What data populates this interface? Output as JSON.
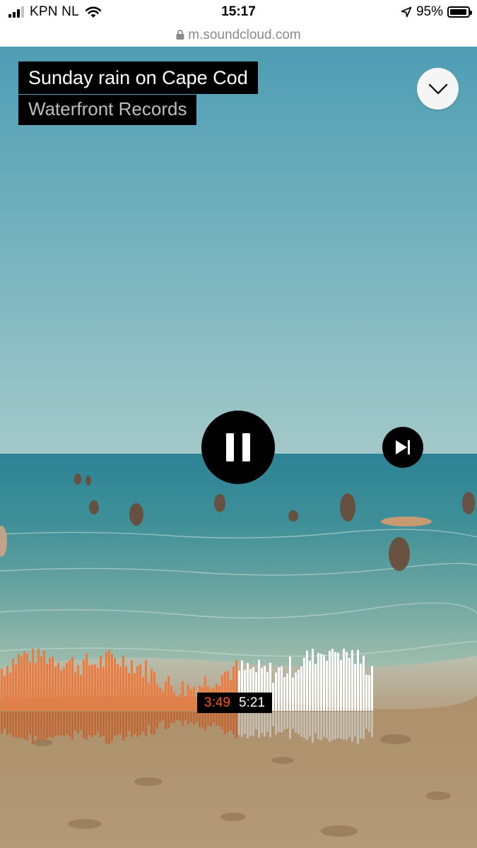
{
  "status_bar": {
    "carrier": "KPN NL",
    "time": "15:17",
    "battery_percent": "95%",
    "battery_level": 0.95,
    "icons": [
      "signal-icon",
      "wifi-icon",
      "location-arrow-icon",
      "battery-icon"
    ]
  },
  "browser": {
    "url": "m.soundcloud.com",
    "icons": [
      "lock-icon"
    ]
  },
  "track": {
    "title": "Sunday rain on Cape Cod",
    "artist": "Waterfront Records"
  },
  "controls": {
    "collapse_icon": "chevron-down-icon",
    "play_state_icon": "pause-icon",
    "next_icon": "skip-next-icon"
  },
  "playback": {
    "current_time": "3:49",
    "total_time": "5:21",
    "progress": 0.635
  },
  "colors": {
    "accent": "#ff5500",
    "played_wave": "#f07a3e",
    "unplayed_wave": "#ffffff"
  }
}
